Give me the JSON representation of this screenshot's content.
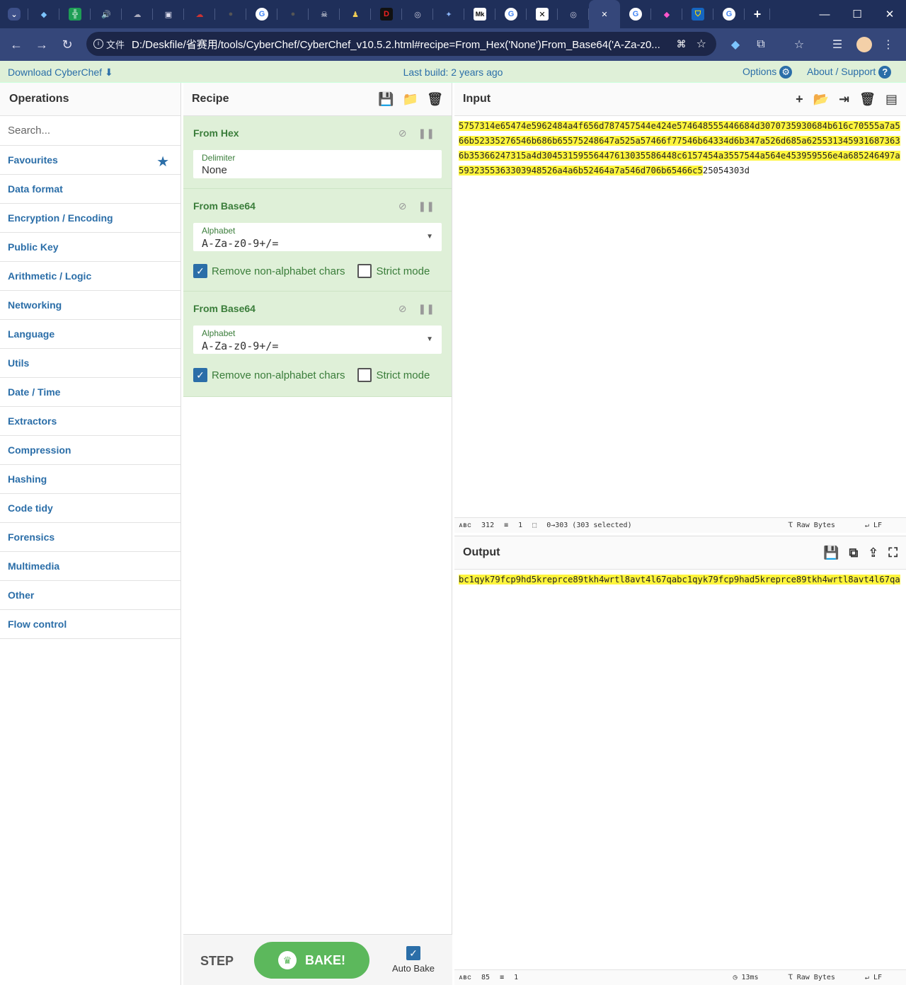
{
  "browser": {
    "address": "D:/Deskfile/省赛用/tools/CyberChef/CyberChef_v10.5.2.html#recipe=From_Hex('None')From_Base64('A-Za-z0...",
    "scheme_label": "文件"
  },
  "banner": {
    "download": "Download CyberChef",
    "last_build": "Last build: 2 years ago",
    "options": "Options",
    "about": "About / Support"
  },
  "operations": {
    "title": "Operations",
    "search_placeholder": "Search...",
    "categories": [
      "Favourites",
      "Data format",
      "Encryption / Encoding",
      "Public Key",
      "Arithmetic / Logic",
      "Networking",
      "Language",
      "Utils",
      "Date / Time",
      "Extractors",
      "Compression",
      "Hashing",
      "Code tidy",
      "Forensics",
      "Multimedia",
      "Other",
      "Flow control"
    ]
  },
  "recipe": {
    "title": "Recipe",
    "ops": [
      {
        "name": "From Hex",
        "field_label": "Delimiter",
        "field_value": "None"
      },
      {
        "name": "From Base64",
        "field_label": "Alphabet",
        "field_value": "A-Za-z0-9+/=",
        "check1": "Remove non-alphabet chars",
        "check2": "Strict mode"
      },
      {
        "name": "From Base64",
        "field_label": "Alphabet",
        "field_value": "A-Za-z0-9+/=",
        "check1": "Remove non-alphabet chars",
        "check2": "Strict mode"
      }
    ],
    "step": "STEP",
    "bake": "BAKE!",
    "auto_bake": "Auto Bake"
  },
  "input": {
    "title": "Input",
    "text_selected": "5757314e65474e5962484a4f656d787457544e424e574648555446684d3070735930684b616c70555a7a566b52335276546b686b65575248647a525a57466f77546b64334d6b347a526d685a6255313459316873636b35366247315a4d30453159556447613035586448c6157454a3557544a564e453959556e4a685246497a5932355363303948526a4a6b52464a7a546d706b65466c5",
    "text_rest": "25054303d",
    "status_chars": "312",
    "status_lines": "1",
    "status_sel": "0→303 (303 selected)",
    "raw_bytes": "Raw Bytes",
    "eol": "LF"
  },
  "output": {
    "title": "Output",
    "text": "bc1qyk79fcp9hd5kreprce89tkh4wrtl8avt4l67qabc1qyk79fcp9had5kreprce89tkh4wrtl8avt4l67qa",
    "status_chars": "85",
    "status_lines": "1",
    "time": "13ms",
    "raw_bytes": "Raw Bytes",
    "eol": "LF"
  }
}
